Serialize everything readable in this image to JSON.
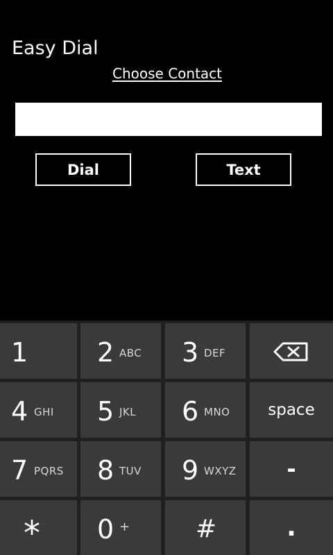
{
  "app": {
    "title": "Easy Dial",
    "choose_contact_label": "Choose Contact"
  },
  "input": {
    "value": "",
    "placeholder": ""
  },
  "actions": {
    "dial_label": "Dial",
    "text_label": "Text"
  },
  "keypad": {
    "rows": [
      [
        {
          "digit": "1",
          "letters": ""
        },
        {
          "digit": "2",
          "letters": "ABC"
        },
        {
          "digit": "3",
          "letters": "DEF"
        },
        {
          "icon": "backspace-icon"
        }
      ],
      [
        {
          "digit": "4",
          "letters": "GHI"
        },
        {
          "digit": "5",
          "letters": "JKL"
        },
        {
          "digit": "6",
          "letters": "MNO"
        },
        {
          "label": "space"
        }
      ],
      [
        {
          "digit": "7",
          "letters": "PQRS"
        },
        {
          "digit": "8",
          "letters": "TUV"
        },
        {
          "digit": "9",
          "letters": "WXYZ"
        },
        {
          "label": "-"
        }
      ],
      [
        {
          "digit": "*",
          "letters": ""
        },
        {
          "digit": "0",
          "letters": "+"
        },
        {
          "digit": "#",
          "letters": ""
        },
        {
          "label": "."
        }
      ]
    ]
  },
  "colors": {
    "background": "#000000",
    "key_background": "#3a3a3a",
    "keypad_gap": "#1f1f1f",
    "text": "#ffffff"
  }
}
